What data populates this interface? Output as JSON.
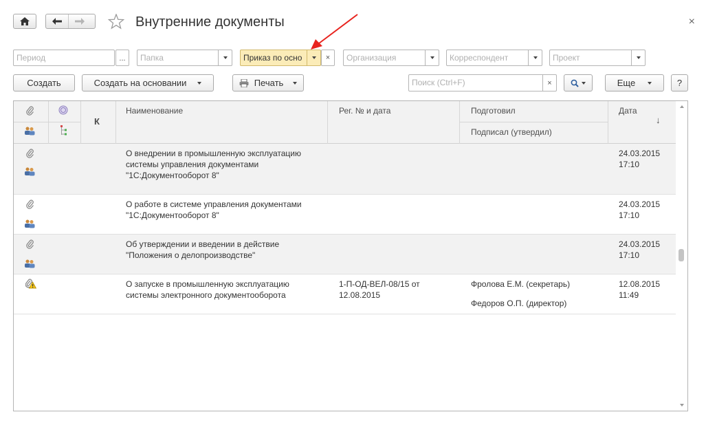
{
  "header": {
    "title": "Внутренние документы",
    "close_glyph": "×"
  },
  "filters": [
    {
      "placeholder": "Период",
      "extra_label": "..."
    },
    {
      "placeholder": "Папка"
    },
    {
      "value": "Приказ по осно"
    },
    {
      "placeholder": "Организация"
    },
    {
      "placeholder": "Корреспондент"
    },
    {
      "placeholder": "Проект"
    }
  ],
  "filter_clear_glyph": "×",
  "toolbar": {
    "create_label": "Создать",
    "create_based_label": "Создать на основании",
    "print_label": "Печать",
    "search_placeholder": "Поиск (Ctrl+F)",
    "search_clear_glyph": "×",
    "more_label": "Еще",
    "help_label": "?"
  },
  "table": {
    "columns": {
      "k": "К",
      "name": "Наименование",
      "reg": "Рег. № и дата",
      "prepared": "Подготовил",
      "signed": "Подписал (утвердил)",
      "date": "Дата",
      "sort_glyph": "↓"
    },
    "rows": [
      {
        "name": [
          "О внедрении в промышленную эксплуатацию",
          "системы управления документами",
          "\"1С:Документооборот 8\""
        ],
        "reg": [
          "",
          ""
        ],
        "prepared": "",
        "signed": "",
        "date": "24.03.2015",
        "time": "17:10"
      },
      {
        "name": [
          "О работе в системе управления документами",
          "\"1С:Документооборот 8\"",
          ""
        ],
        "reg": [
          "",
          ""
        ],
        "prepared": "",
        "signed": "",
        "date": "24.03.2015",
        "time": "17:10"
      },
      {
        "name": [
          "Об утверждении и введении в действие",
          "\"Положения о делопроизводстве\"",
          ""
        ],
        "reg": [
          "",
          ""
        ],
        "prepared": "",
        "signed": "",
        "date": "24.03.2015",
        "time": "17:10"
      },
      {
        "name": [
          "О запуске в промышленную эксплуатацию",
          "системы электронного документооборота",
          ""
        ],
        "reg": [
          "1-П-ОД-ВЕЛ-08/15 от",
          "12.08.2015"
        ],
        "prepared": "Фролова Е.М. (секретарь)",
        "signed": "Федоров О.П. (директор)",
        "date": "12.08.2015",
        "time": "11:49"
      }
    ]
  },
  "colors": {
    "active_filter_bg": "#fbecb8",
    "alt_row_bg": "#f2f2f2",
    "annotation_arrow": "#e8231e"
  }
}
